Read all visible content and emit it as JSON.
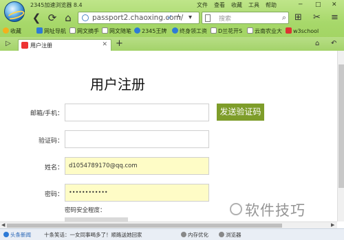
{
  "browser": {
    "title": "2345加速浏览器 8.4",
    "menu": [
      "文件",
      "查看",
      "收藏",
      "工具",
      "帮助"
    ],
    "window_buttons": [
      "─",
      "□",
      "✕"
    ],
    "address": "passport2.chaoxing.com/",
    "search_placeholder": "搜索",
    "accent_color": "#a7d86a"
  },
  "bookmarks": [
    {
      "label": "收藏",
      "icon": "star-icon",
      "color": "#f2b01e"
    },
    {
      "label": "网址导航",
      "icon": "home-icon",
      "color": "#2e7bd6"
    },
    {
      "label": "网文摘手",
      "icon": "page-icon",
      "color": "#ffffff"
    },
    {
      "label": "网文随笔",
      "icon": "page-icon",
      "color": "#ffffff"
    },
    {
      "label": "2345王牌",
      "icon": "globe-icon",
      "color": "#2e7bd6"
    },
    {
      "label": "终身领工资",
      "icon": "globe-icon",
      "color": "#2e7bd6"
    },
    {
      "label": "D兰花开S",
      "icon": "page-icon",
      "color": "#ffffff"
    },
    {
      "label": "云南农业大",
      "icon": "page-icon",
      "color": "#ffffff"
    },
    {
      "label": "w3school",
      "icon": "w3-icon",
      "color": "#d33"
    }
  ],
  "tab": {
    "label": "用户注册"
  },
  "form": {
    "title": "用户注册",
    "email_label": "邮箱/手机：",
    "email_value": "",
    "code_label": "验证码：",
    "code_value": "",
    "send_code_button": "发送验证码",
    "name_label": "姓名：",
    "name_value": "d1054789170@qq.com",
    "password_label": "密码：",
    "password_value": "••••••••••••",
    "strength_label": "密码安全程度："
  },
  "statusbar": {
    "news": "头条新闻",
    "headline": "十条笑话：一女同事喝多了！顺路送她回家",
    "optimize": "内存优化",
    "accelerate": "浏览器"
  },
  "watermark": "软件技巧"
}
